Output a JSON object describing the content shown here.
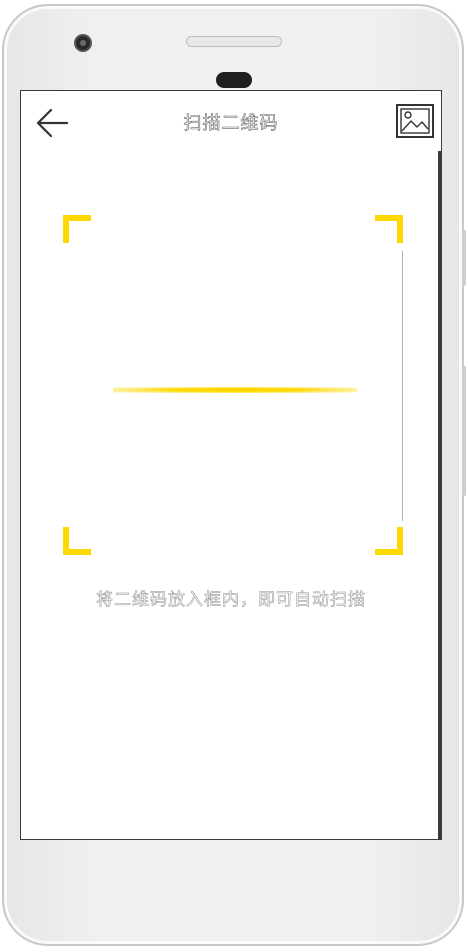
{
  "header": {
    "title": "扫描二维码",
    "back_icon": "arrow-left-icon",
    "gallery_icon": "image-icon"
  },
  "scanner": {
    "accent_color": "#ffd800",
    "hint": "将二维码放入框内，即可自动扫描"
  }
}
